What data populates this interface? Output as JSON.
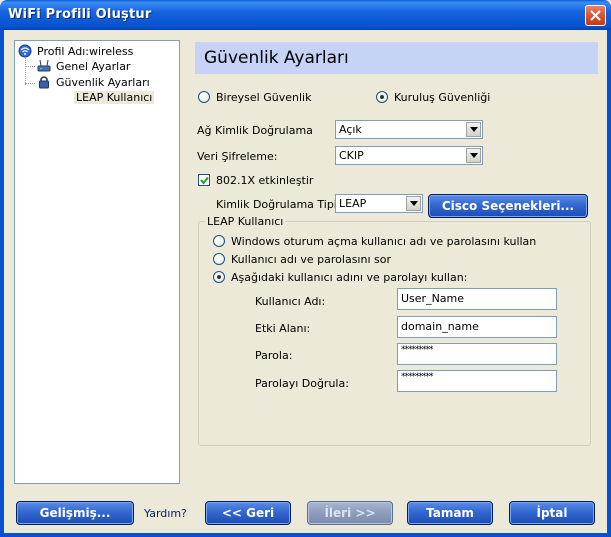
{
  "window": {
    "title": "WiFi Profili Oluştur"
  },
  "tree": {
    "root": "Profil Adı:wireless",
    "items": [
      "Genel Ayarlar",
      "Güvenlik Ayarları"
    ],
    "subitem": "LEAP Kullanıcı"
  },
  "header": {
    "title": "Güvenlik Ayarları"
  },
  "security_mode": {
    "personal": "Bireysel Güvenlik",
    "enterprise": "Kuruluş Güvenliği",
    "selected": "enterprise"
  },
  "auth": {
    "label": "Ağ Kimlik Doğrulama",
    "value": "Açık"
  },
  "encryption": {
    "label": "Veri Şifreleme:",
    "value": "CKIP"
  },
  "dot1x": {
    "label": "802.1X etkinleştir",
    "checked": true
  },
  "eap_type": {
    "label": "Kimlik Doğrulama Tipi:",
    "value": "LEAP"
  },
  "cisco_button": "Cisco Seçenekleri...",
  "leap": {
    "group_title": "LEAP Kullanıcı",
    "opt_windows": "Windows oturum açma kullanıcı adı ve parolasını kullan",
    "opt_prompt": "Kullanıcı adı ve parolasını sor",
    "opt_manual": "Aşağıdaki kullanıcı adını ve parolayı kullan:",
    "selected": "manual",
    "username_label": "Kullanıcı Adı:",
    "username_value": "User_Name",
    "domain_label": "Etki Alanı:",
    "domain_value": "domain_name",
    "password_label": "Parola:",
    "password_value": "*********",
    "confirm_label": "Parolayı Doğrula:",
    "confirm_value": "*********"
  },
  "footer": {
    "advanced": "Gelişmiş...",
    "help": "Yardım?",
    "back": "<< Geri",
    "next": "İleri >>",
    "ok": "Tamam",
    "cancel": "İptal"
  }
}
